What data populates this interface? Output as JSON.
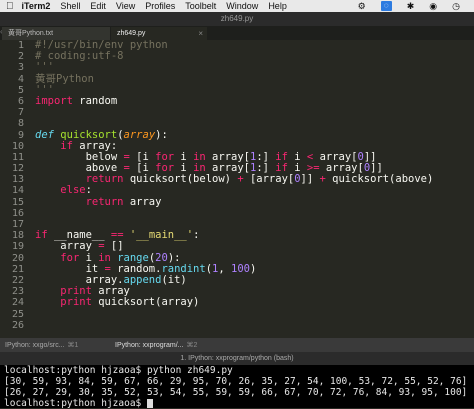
{
  "menubar": {
    "app": "iTerm2",
    "items": [
      "Shell",
      "Edit",
      "View",
      "Profiles",
      "Toolbelt",
      "Window",
      "Help"
    ],
    "right_icons": [
      "status-icon",
      "status-box-icon",
      "bluetooth-icon",
      "wifi-icon",
      "clock-icon"
    ]
  },
  "window": {
    "title": "zh649.py"
  },
  "tabs": [
    {
      "label": "黄哥Python.txt",
      "active": false
    },
    {
      "label": "zh649.py",
      "active": true
    }
  ],
  "editor": {
    "line_numbers": [
      "1",
      "2",
      "3",
      "4",
      "5",
      "6",
      "7",
      "8",
      "9",
      "10",
      "11",
      "12",
      "13",
      "14",
      "15",
      "16",
      "17",
      "18",
      "19",
      "20",
      "21",
      "22",
      "23",
      "24",
      "25",
      "26"
    ],
    "lines": [
      [
        [
          "#!/usr/bin/env python",
          "cm"
        ]
      ],
      [
        [
          "# coding:utf-8",
          "cm"
        ]
      ],
      [
        [
          "'''",
          "cm"
        ]
      ],
      [
        [
          "黄哥Python",
          "cm"
        ]
      ],
      [
        [
          "'''",
          "cm"
        ]
      ],
      [
        [
          "import",
          "kw"
        ],
        [
          " random",
          ""
        ]
      ],
      [],
      [],
      [
        [
          "def",
          "def"
        ],
        [
          " ",
          ""
        ],
        [
          "quicksort",
          "fn"
        ],
        [
          "(",
          ""
        ],
        [
          "array",
          "arg"
        ],
        [
          "):",
          ""
        ]
      ],
      [
        [
          "    ",
          ""
        ],
        [
          "if",
          "kw"
        ],
        [
          " array:",
          ""
        ]
      ],
      [
        [
          "        below ",
          ""
        ],
        [
          "=",
          "kw"
        ],
        [
          " [i ",
          ""
        ],
        [
          "for",
          "kw"
        ],
        [
          " i ",
          ""
        ],
        [
          "in",
          "kw"
        ],
        [
          " array[",
          ""
        ],
        [
          "1",
          "nm"
        ],
        [
          ":] ",
          ""
        ],
        [
          "if",
          "kw"
        ],
        [
          " i ",
          ""
        ],
        [
          "<",
          "kw"
        ],
        [
          " array[",
          ""
        ],
        [
          "0",
          "nm"
        ],
        [
          "]]",
          ""
        ]
      ],
      [
        [
          "        above ",
          ""
        ],
        [
          "=",
          "kw"
        ],
        [
          " [i ",
          ""
        ],
        [
          "for",
          "kw"
        ],
        [
          " i ",
          ""
        ],
        [
          "in",
          "kw"
        ],
        [
          " array[",
          ""
        ],
        [
          "1",
          "nm"
        ],
        [
          ":] ",
          ""
        ],
        [
          "if",
          "kw"
        ],
        [
          " i ",
          ""
        ],
        [
          ">=",
          "kw"
        ],
        [
          " array[",
          ""
        ],
        [
          "0",
          "nm"
        ],
        [
          "]]",
          ""
        ]
      ],
      [
        [
          "        ",
          ""
        ],
        [
          "return",
          "kw"
        ],
        [
          " quicksort(below) ",
          ""
        ],
        [
          "+",
          "kw"
        ],
        [
          " [array[",
          ""
        ],
        [
          "0",
          "nm"
        ],
        [
          "]] ",
          ""
        ],
        [
          "+",
          "kw"
        ],
        [
          " quicksort(above)",
          ""
        ]
      ],
      [
        [
          "    ",
          ""
        ],
        [
          "else",
          "kw"
        ],
        [
          ":",
          ""
        ]
      ],
      [
        [
          "        ",
          ""
        ],
        [
          "return",
          "kw"
        ],
        [
          " array",
          ""
        ]
      ],
      [],
      [],
      [
        [
          "if",
          "kw"
        ],
        [
          " __name__ ",
          ""
        ],
        [
          "==",
          "kw"
        ],
        [
          " ",
          ""
        ],
        [
          "'__main__'",
          "st"
        ],
        [
          ":",
          ""
        ]
      ],
      [
        [
          "    array ",
          ""
        ],
        [
          "=",
          "kw"
        ],
        [
          " []",
          ""
        ]
      ],
      [
        [
          "    ",
          ""
        ],
        [
          "for",
          "kw"
        ],
        [
          " i ",
          ""
        ],
        [
          "in",
          "kw"
        ],
        [
          " ",
          ""
        ],
        [
          "range",
          "bi"
        ],
        [
          "(",
          ""
        ],
        [
          "20",
          "nm"
        ],
        [
          "):",
          ""
        ]
      ],
      [
        [
          "        it ",
          ""
        ],
        [
          "=",
          "kw"
        ],
        [
          " random.",
          ""
        ],
        [
          "randint",
          "bi"
        ],
        [
          "(",
          ""
        ],
        [
          "1",
          "nm"
        ],
        [
          ", ",
          ""
        ],
        [
          "100",
          "nm"
        ],
        [
          ")",
          ""
        ]
      ],
      [
        [
          "        array.",
          ""
        ],
        [
          "append",
          "bi"
        ],
        [
          "(it)",
          ""
        ]
      ],
      [
        [
          "    ",
          ""
        ],
        [
          "print",
          "kw"
        ],
        [
          " array",
          ""
        ]
      ],
      [
        [
          "    ",
          ""
        ],
        [
          "print",
          "kw"
        ],
        [
          " quicksort(array)",
          ""
        ]
      ],
      [],
      []
    ]
  },
  "terminal_tabs": [
    {
      "label": "IPython: xxgo/src...",
      "shortcut": "⌘1"
    },
    {
      "label": "IPython: xxprogram/...",
      "shortcut": "⌘2"
    }
  ],
  "terminal": {
    "title": "1. IPython: xxprogram/python (bash)",
    "lines": [
      "localhost:python hjzaoa$ python zh649.py",
      "[30, 59, 93, 84, 59, 67, 66, 29, 95, 70, 26, 35, 27, 54, 100, 53, 72, 55, 52, 76]",
      "[26, 27, 29, 30, 35, 52, 53, 54, 55, 59, 59, 66, 67, 70, 72, 76, 84, 93, 95, 100]",
      "localhost:python hjzaoa$ "
    ]
  }
}
